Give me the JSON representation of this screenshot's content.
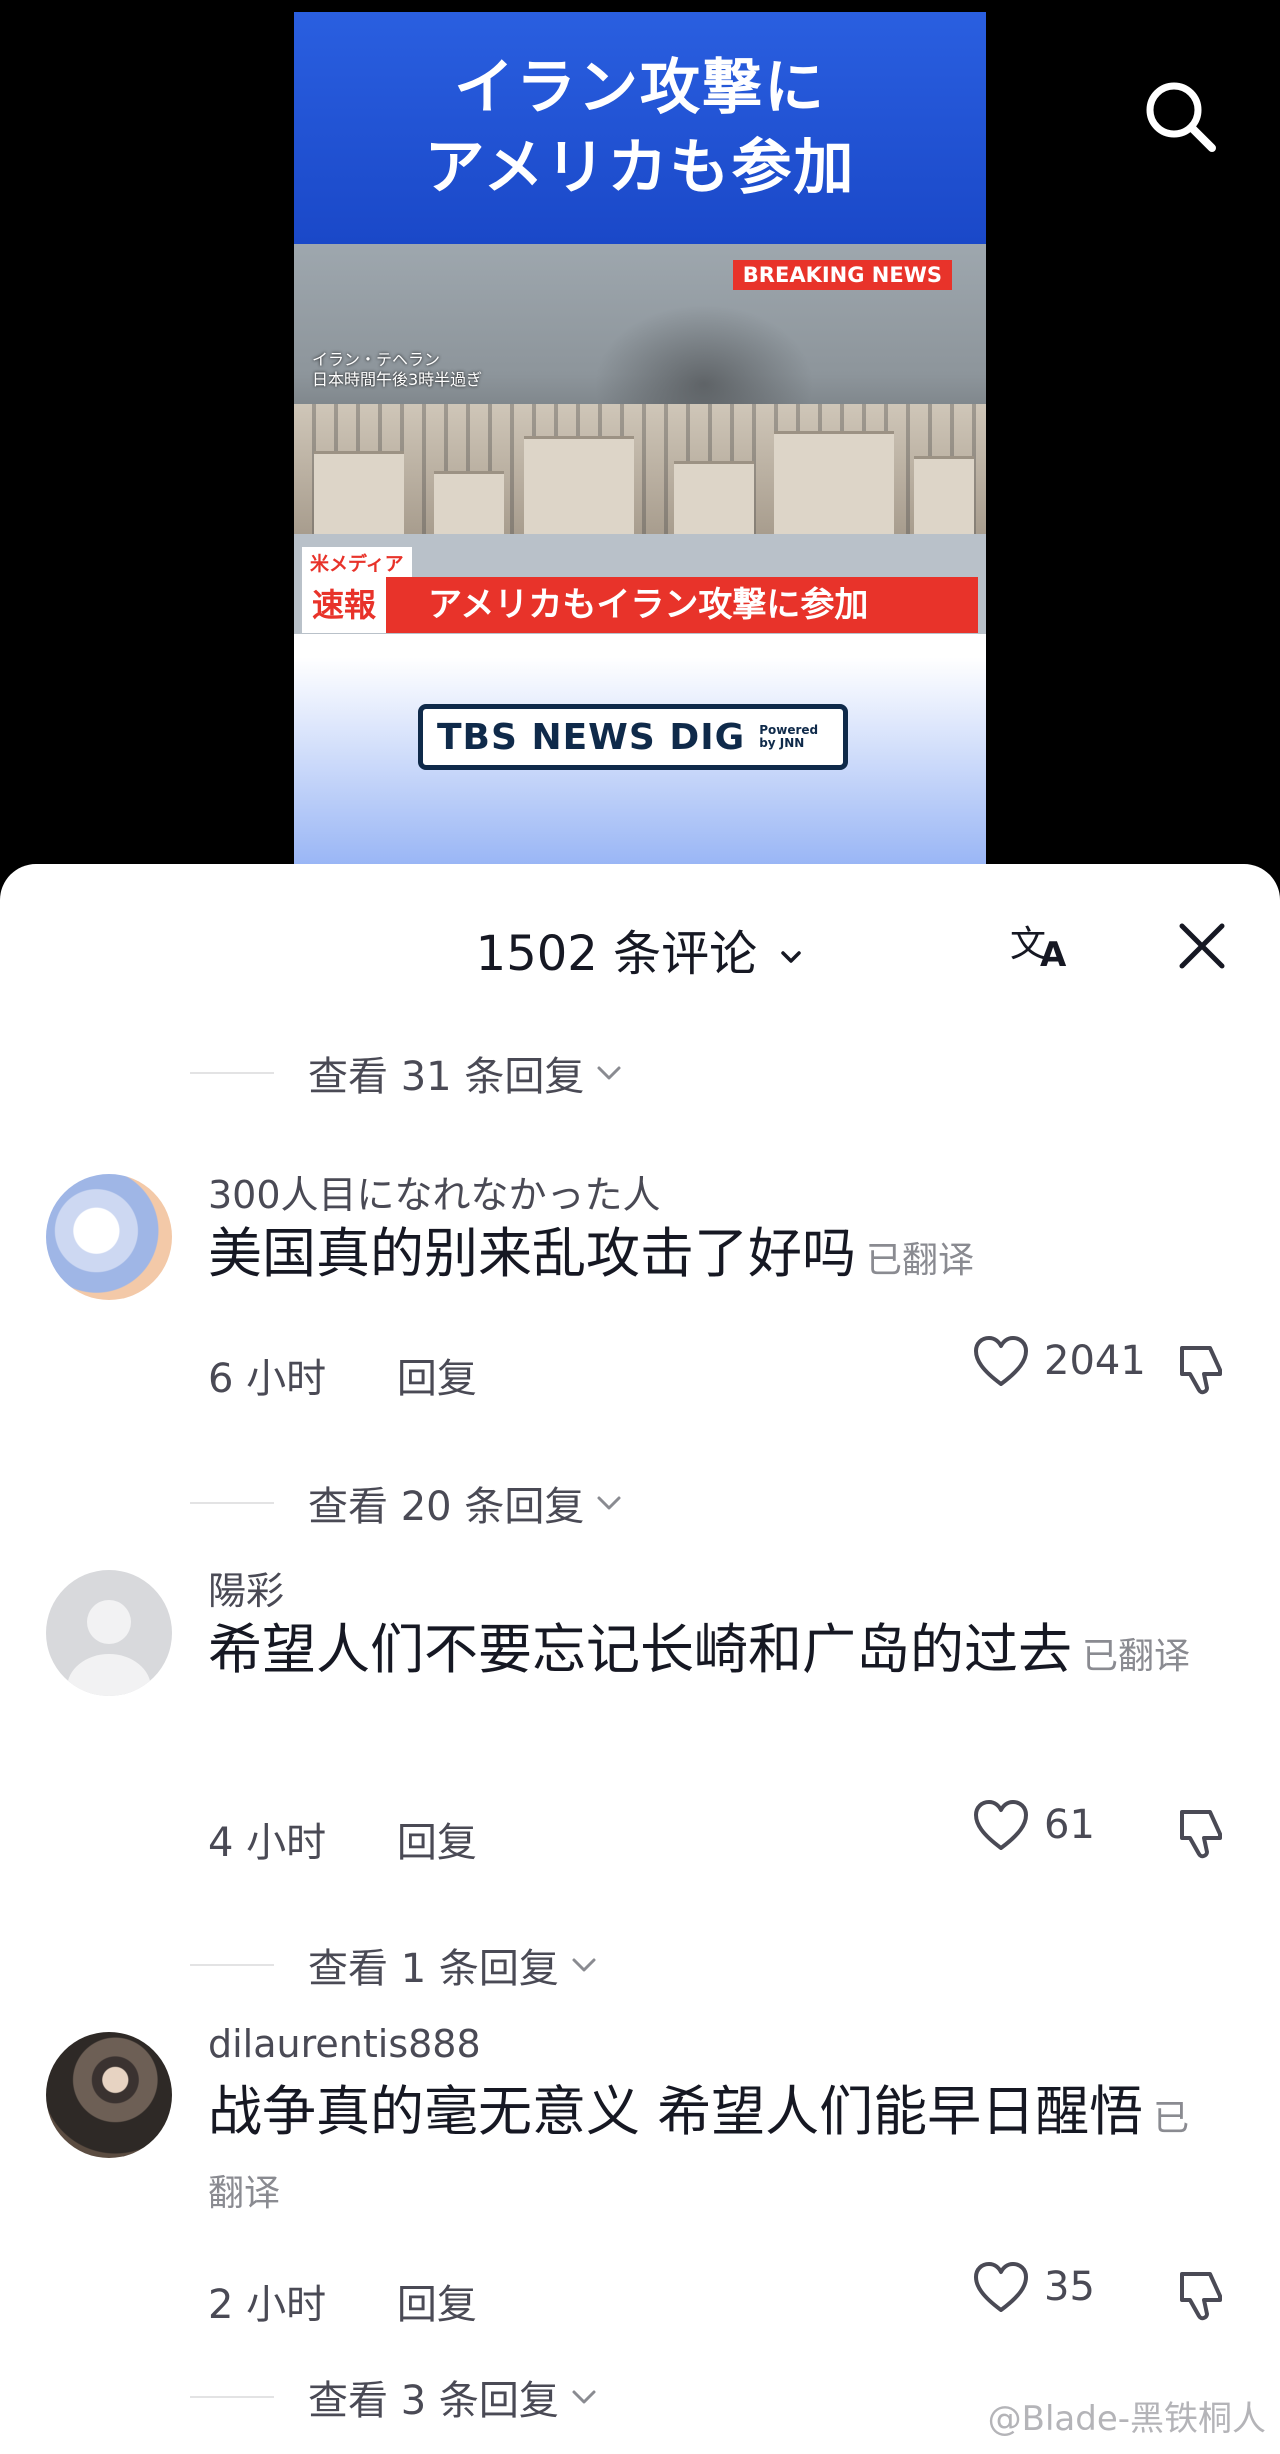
{
  "video": {
    "headline_line1": "イラン攻撃に",
    "headline_line2": "アメリカも参加",
    "breaking_tag": "BREAKING NEWS",
    "location_line1": "イラン・テヘラン",
    "location_line2": "日本時間午後3時半過ぎ",
    "ticker_source": "米メディア",
    "ticker_tag": "速報",
    "ticker_text": "アメリカもイラン攻撃に参加",
    "logo_text": "TBS NEWS DIG",
    "logo_powered_line1": "Powered",
    "logo_powered_line2": "by JNN",
    "search_icon": "search-icon"
  },
  "sheet": {
    "comment_count": "1502 条评论",
    "translate_icon": "translate-icon",
    "close_icon": "close-icon"
  },
  "replies_toggles": [
    {
      "label": "查看 31 条回复"
    },
    {
      "label": "查看 20 条回复"
    },
    {
      "label": "查看 1 条回复"
    },
    {
      "label": "查看 3 条回复"
    }
  ],
  "comments": [
    {
      "user": "300人目になれなかった人",
      "text": "美国真的别来乱攻击了好吗",
      "translated": "已翻译",
      "time": "6 小时",
      "reply": "回复",
      "likes": "2041"
    },
    {
      "user": "陽彩",
      "text": "希望人们不要忘记长崎和广岛的过去",
      "translated": "已翻译",
      "time": "4 小时",
      "reply": "回复",
      "likes": "61"
    },
    {
      "user": "dilaurentis888",
      "text": "战争真的毫无意义 希望人们能早日醒悟",
      "translated": "已翻译",
      "time": "2 小时",
      "reply": "回复",
      "likes": "35"
    }
  ],
  "watermark": "@Blade-黑铁桐人"
}
